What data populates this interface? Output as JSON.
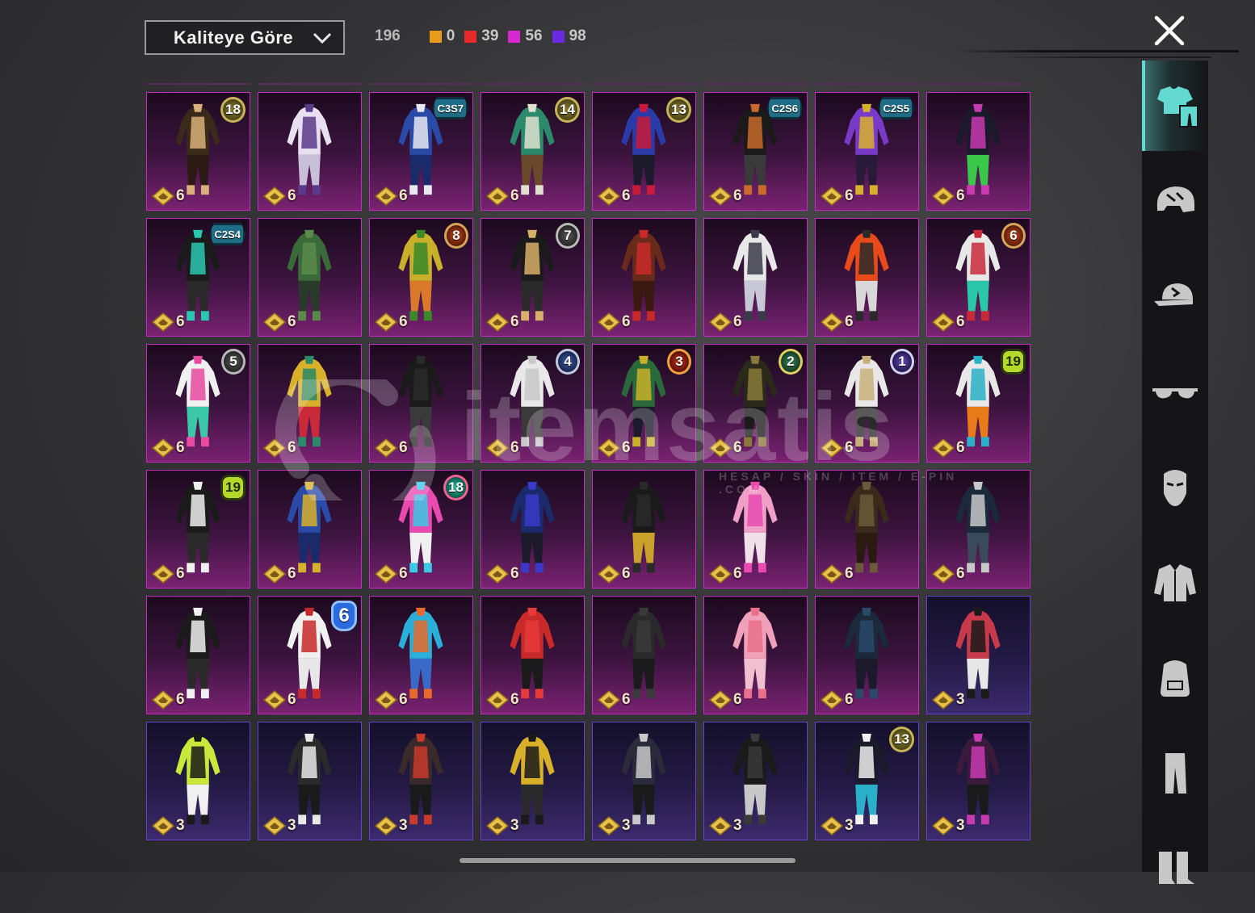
{
  "toolbar": {
    "sort_label": "Kaliteye Göre",
    "total_count": "196",
    "quality_counts": [
      {
        "color": "#e89a1a",
        "value": "0"
      },
      {
        "color": "#e62a2a",
        "value": "39"
      },
      {
        "color": "#d62ad0",
        "value": "56"
      },
      {
        "color": "#6a2ae0",
        "value": "98"
      }
    ]
  },
  "watermark": {
    "text": "itemsatis",
    "sub": "HESAP / SKIN / ITEM / E-PIN .COM"
  },
  "sidebar": {
    "icons": [
      "outfit-icon",
      "helmet-icon",
      "cap-icon",
      "glasses-icon",
      "mask-icon",
      "jacket-icon",
      "backpack-icon",
      "pants-icon",
      "boots-icon"
    ]
  },
  "grid": {
    "items": [
      {
        "tier": "6",
        "badge": "18",
        "badge_style": "gold",
        "quality": "pink",
        "colors": [
          "#3a2a1a",
          "#d9b07a",
          "#2a1a12"
        ]
      },
      {
        "tier": "6",
        "badge": "",
        "badge_style": "",
        "quality": "pink",
        "colors": [
          "#e8e0f0",
          "#5a3a8a",
          "#c8c0d8"
        ]
      },
      {
        "tier": "6",
        "badge": "C3S7",
        "badge_style": "season",
        "quality": "pink",
        "colors": [
          "#2a4aa8",
          "#e8e8f0",
          "#1a2a6a"
        ]
      },
      {
        "tier": "6",
        "badge": "14",
        "badge_style": "gold",
        "quality": "pink",
        "colors": [
          "#2a8a6a",
          "#e0e0d0",
          "#6a4a2a"
        ]
      },
      {
        "tier": "6",
        "badge": "13",
        "badge_style": "gold",
        "quality": "pink",
        "colors": [
          "#2a3aa8",
          "#c81a3a",
          "#1a1a2a"
        ]
      },
      {
        "tier": "6",
        "badge": "C2S6",
        "badge_style": "season",
        "quality": "pink",
        "colors": [
          "#1a1a1a",
          "#c86a2a",
          "#3a3a3a"
        ]
      },
      {
        "tier": "6",
        "badge": "C2S5",
        "badge_style": "season",
        "quality": "pink",
        "colors": [
          "#7a3ac8",
          "#d8b02a",
          "#2a1a3a"
        ]
      },
      {
        "tier": "6",
        "badge": "",
        "badge_style": "",
        "quality": "pink",
        "colors": [
          "#1a1a2a",
          "#c83ab0",
          "#3ac84a"
        ]
      },
      {
        "tier": "6",
        "badge": "C2S4",
        "badge_style": "season",
        "quality": "pink",
        "colors": [
          "#1a1a1a",
          "#2ac8b0",
          "#2a2a2a"
        ]
      },
      {
        "tier": "6",
        "badge": "",
        "badge_style": "",
        "quality": "pink",
        "colors": [
          "#3a6a3a",
          "#5a8a4a",
          "#2a3a2a"
        ]
      },
      {
        "tier": "6",
        "badge": "8",
        "badge_style": "orange",
        "quality": "pink",
        "colors": [
          "#c8b02a",
          "#3a8a2a",
          "#d87a2a"
        ]
      },
      {
        "tier": "6",
        "badge": "7",
        "badge_style": "dark",
        "quality": "pink",
        "colors": [
          "#1a1a1a",
          "#d8b06a",
          "#2a2a2a"
        ]
      },
      {
        "tier": "6",
        "badge": "",
        "badge_style": "",
        "quality": "pink",
        "colors": [
          "#6a2a1a",
          "#c82a2a",
          "#3a1a10"
        ]
      },
      {
        "tier": "6",
        "badge": "",
        "badge_style": "",
        "quality": "pink",
        "colors": [
          "#e8e8e8",
          "#3a3a4a",
          "#c8c8d8"
        ]
      },
      {
        "tier": "6",
        "badge": "",
        "badge_style": "",
        "quality": "pink",
        "colors": [
          "#e84a1a",
          "#2a2a2a",
          "#d8d8d8"
        ]
      },
      {
        "tier": "6",
        "badge": "6",
        "badge_style": "orange",
        "quality": "pink",
        "colors": [
          "#e8e8e8",
          "#c82a3a",
          "#2ac8a8"
        ]
      },
      {
        "tier": "6",
        "badge": "5",
        "badge_style": "dark",
        "quality": "pink",
        "colors": [
          "#f0f0f0",
          "#e84aa0",
          "#3ac8a8"
        ]
      },
      {
        "tier": "6",
        "badge": "",
        "badge_style": "",
        "quality": "pink",
        "colors": [
          "#d8b02a",
          "#2a8a6a",
          "#c82a3a"
        ]
      },
      {
        "tier": "6",
        "badge": "",
        "badge_style": "",
        "quality": "pink",
        "colors": [
          "#1a1a1a",
          "#2a2a2a",
          "#3a3a3a"
        ]
      },
      {
        "tier": "6",
        "badge": "4",
        "badge_style": "blue",
        "quality": "pink",
        "colors": [
          "#e8e8e8",
          "#c8c8c8",
          "#3a3a3a"
        ]
      },
      {
        "tier": "6",
        "badge": "3",
        "badge_style": "red",
        "quality": "pink",
        "colors": [
          "#2a6a3a",
          "#c8b02a",
          "#1a1a2a"
        ]
      },
      {
        "tier": "6",
        "badge": "2",
        "badge_style": "green",
        "quality": "pink",
        "colors": [
          "#2a2a1a",
          "#8a7a3a",
          "#1a1a1a"
        ]
      },
      {
        "tier": "6",
        "badge": "1",
        "badge_style": "violet",
        "quality": "pink",
        "colors": [
          "#e8e8e8",
          "#c8b07a",
          "#2a2a2a"
        ]
      },
      {
        "tier": "6",
        "badge": "19",
        "badge_style": "lime",
        "quality": "pink",
        "colors": [
          "#e8e8e8",
          "#2ab0c8",
          "#e87a1a"
        ]
      },
      {
        "tier": "6",
        "badge": "19",
        "badge_style": "lime",
        "quality": "pink",
        "colors": [
          "#1a1a1a",
          "#f0f0f0",
          "#2a2a2a"
        ]
      },
      {
        "tier": "6",
        "badge": "",
        "badge_style": "",
        "quality": "pink",
        "colors": [
          "#2a4aa8",
          "#d8b02a",
          "#1a2a6a"
        ]
      },
      {
        "tier": "6",
        "badge": "18",
        "badge_style": "teal",
        "quality": "pink",
        "colors": [
          "#e84ab0",
          "#3ac8e8",
          "#f0f0f0"
        ]
      },
      {
        "tier": "6",
        "badge": "",
        "badge_style": "",
        "quality": "pink",
        "colors": [
          "#1a2a6a",
          "#3a3ac8",
          "#1a1a2a"
        ]
      },
      {
        "tier": "6",
        "badge": "",
        "badge_style": "",
        "quality": "pink",
        "colors": [
          "#1a1a1a",
          "#2a2a2a",
          "#c8a02a"
        ]
      },
      {
        "tier": "6",
        "badge": "",
        "badge_style": "",
        "quality": "pink",
        "colors": [
          "#f0a0c8",
          "#e84ab0",
          "#f0e0e8"
        ]
      },
      {
        "tier": "6",
        "badge": "",
        "badge_style": "",
        "quality": "pink",
        "colors": [
          "#3a2a1a",
          "#6a5a3a",
          "#2a1a10"
        ]
      },
      {
        "tier": "6",
        "badge": "",
        "badge_style": "",
        "quality": "pink",
        "colors": [
          "#1a2a3a",
          "#c8c8c8",
          "#3a4a5a"
        ]
      },
      {
        "tier": "6",
        "badge": "",
        "badge_style": "",
        "quality": "pink",
        "colors": [
          "#1a1a1a",
          "#f0f0f0",
          "#2a2a2a"
        ]
      },
      {
        "tier": "6",
        "badge": "6",
        "badge_style": "six",
        "quality": "pink",
        "colors": [
          "#f0f0f0",
          "#c82a2a",
          "#e8e8e8"
        ]
      },
      {
        "tier": "6",
        "badge": "",
        "badge_style": "",
        "quality": "pink",
        "colors": [
          "#2ab0d8",
          "#e86a2a",
          "#3a6ac8"
        ]
      },
      {
        "tier": "6",
        "badge": "",
        "badge_style": "",
        "quality": "pink",
        "colors": [
          "#c82a2a",
          "#e83a3a",
          "#1a1a1a"
        ]
      },
      {
        "tier": "6",
        "badge": "",
        "badge_style": "",
        "quality": "pink",
        "colors": [
          "#2a2a2a",
          "#3a3a3a",
          "#1a1a1a"
        ]
      },
      {
        "tier": "6",
        "badge": "",
        "badge_style": "",
        "quality": "pink",
        "colors": [
          "#f0a0b8",
          "#e8708a",
          "#f0c0d0"
        ]
      },
      {
        "tier": "6",
        "badge": "",
        "badge_style": "",
        "quality": "pink",
        "colors": [
          "#1a2a3a",
          "#2a4a6a",
          "#1a1a2a"
        ]
      },
      {
        "tier": "3",
        "badge": "",
        "badge_style": "",
        "quality": "purple",
        "colors": [
          "#c83a4a",
          "#1a1a1a",
          "#e8e8e8"
        ]
      },
      {
        "tier": "3",
        "badge": "",
        "badge_style": "",
        "quality": "purple",
        "colors": [
          "#c8e83a",
          "#1a1a1a",
          "#f0f0f0"
        ]
      },
      {
        "tier": "3",
        "badge": "",
        "badge_style": "",
        "quality": "purple",
        "colors": [
          "#2a2a2a",
          "#e8e8e8",
          "#1a1a1a"
        ]
      },
      {
        "tier": "3",
        "badge": "",
        "badge_style": "",
        "quality": "purple",
        "colors": [
          "#3a2a2a",
          "#c83a2a",
          "#1a1a1a"
        ]
      },
      {
        "tier": "3",
        "badge": "",
        "badge_style": "",
        "quality": "purple",
        "colors": [
          "#d8b02a",
          "#1a1a1a",
          "#2a2a2a"
        ]
      },
      {
        "tier": "3",
        "badge": "",
        "badge_style": "",
        "quality": "purple",
        "colors": [
          "#2a2a3a",
          "#c8c8c8",
          "#1a1a1a"
        ]
      },
      {
        "tier": "3",
        "badge": "",
        "badge_style": "",
        "quality": "purple",
        "colors": [
          "#1a1a1a",
          "#3a3a3a",
          "#c8c8c8"
        ]
      },
      {
        "tier": "3",
        "badge": "13",
        "badge_style": "gold",
        "quality": "purple",
        "colors": [
          "#1a1a2a",
          "#f0f0f0",
          "#2ab0c8"
        ]
      },
      {
        "tier": "3",
        "badge": "",
        "badge_style": "",
        "quality": "purple",
        "colors": [
          "#3a1a3a",
          "#c83ab0",
          "#1a1a1a"
        ]
      }
    ]
  }
}
